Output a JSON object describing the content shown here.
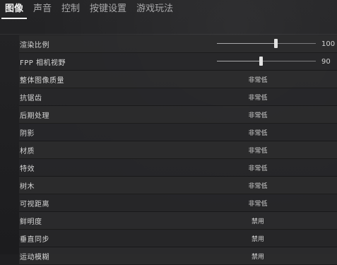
{
  "tabs": [
    {
      "label": "图像",
      "active": true
    },
    {
      "label": "声音",
      "active": false
    },
    {
      "label": "控制",
      "active": false
    },
    {
      "label": "按键设置",
      "active": false
    },
    {
      "label": "游戏玩法",
      "active": false
    }
  ],
  "settings": [
    {
      "label": "渲染比例",
      "type": "slider",
      "value": "100",
      "fraction": 0.59
    },
    {
      "label": "FPP 相机视野",
      "type": "slider",
      "value": "90",
      "fraction": 0.44
    },
    {
      "label": "整体图像质量",
      "type": "select",
      "value": "非常低"
    },
    {
      "label": "抗锯齿",
      "type": "select",
      "value": "非常低"
    },
    {
      "label": "后期处理",
      "type": "select",
      "value": "非常低"
    },
    {
      "label": "阴影",
      "type": "select",
      "value": "非常低"
    },
    {
      "label": "材质",
      "type": "select",
      "value": "非常低"
    },
    {
      "label": "特效",
      "type": "select",
      "value": "非常低"
    },
    {
      "label": "树木",
      "type": "select",
      "value": "非常低"
    },
    {
      "label": "可视距离",
      "type": "select",
      "value": "非常低"
    },
    {
      "label": "鲜明度",
      "type": "select",
      "value": "禁用"
    },
    {
      "label": "垂直同步",
      "type": "select",
      "value": "禁用"
    },
    {
      "label": "运动模糊",
      "type": "select",
      "value": "禁用"
    }
  ]
}
